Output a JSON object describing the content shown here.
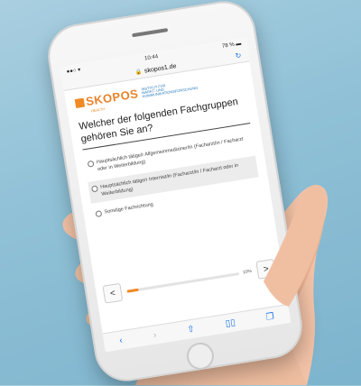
{
  "status_bar": {
    "time": "10:44",
    "carrier": "●●○ ▾",
    "battery": "78 % ▬"
  },
  "browser": {
    "url": "skopos1.de",
    "lock_icon": "lock-icon",
    "reload_icon": "reload-icon"
  },
  "logo": {
    "brand": "SKOPOS",
    "tagline": "INSTITUT FÜR MARKT- UND KOMMUNIKATIONSFORSCHUNG",
    "sub": "HEALTH"
  },
  "survey": {
    "question": "Welcher der folgenden Fachgruppen gehören Sie an?",
    "options": [
      {
        "label": "Hauptsächlich tätige/r Allgemeinmediziner/in (Facharzt/in / Facharzt oder in Weiterbildung)"
      },
      {
        "label": "Hauptsächlich tätige/r Internist/in (Facharzt/in / Facharzt oder in Weiterbildung)"
      },
      {
        "label": "Sonstige Fachrichtung"
      }
    ],
    "progress_label": "10%",
    "progress_value": 0.1,
    "prev_label": "<",
    "next_label": ">"
  },
  "toolbar_icons": [
    "back-icon",
    "forward-icon",
    "share-icon",
    "bookmarks-icon",
    "tabs-icon"
  ],
  "colors": {
    "brand_orange": "#f08a24",
    "ios_blue": "#1a73e8",
    "background": "#8fc0d6"
  }
}
